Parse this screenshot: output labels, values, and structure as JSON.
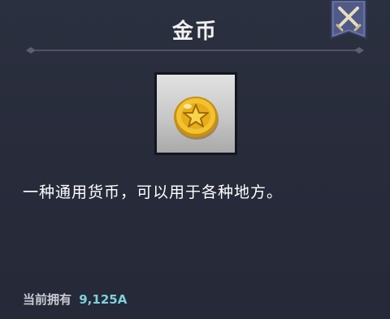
{
  "dialog": {
    "title": "金币",
    "close_icon": "crossed-swords-icon"
  },
  "item": {
    "icon": "gold-coin-star-icon",
    "description": "一种通用货币，可以用于各种地方。"
  },
  "owned": {
    "label": "当前拥有",
    "value": "9,125A"
  },
  "colors": {
    "background": "#262a38",
    "accent_value": "#7ed0d9",
    "close_banner": "#4f5a86",
    "coin_gold": "#f2c230"
  }
}
